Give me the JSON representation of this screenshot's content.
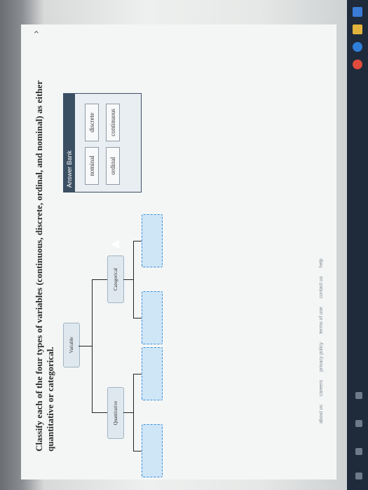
{
  "question": "Classify each of the four types of variables (continuous, discrete, ordinal, and nominal) as either quantitative or categorical.",
  "tree": {
    "root": "Variable",
    "left": "Quantitative",
    "right": "Categorical"
  },
  "answer_bank": {
    "title": "Answer Bank",
    "items": [
      "nominal",
      "discrete",
      "ordinal",
      "continuous"
    ]
  },
  "footer_links": [
    "about us",
    "careers",
    "privacy policy",
    "terms of use",
    "contact us",
    "help"
  ],
  "nav": {
    "next_icon": "chevron-right-icon",
    "next_glyph": "›"
  },
  "colors": {
    "drop_target": "#cfe6f7",
    "answer_header": "#3b4f63"
  }
}
